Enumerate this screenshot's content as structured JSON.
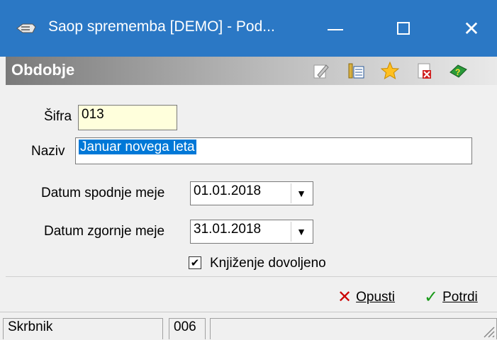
{
  "window": {
    "title": "Saop sprememba [DEMO] - Pod...",
    "minimize": "minimize",
    "maximize": "maximize",
    "close": "close"
  },
  "header": {
    "title": "Obdobje",
    "tools": [
      "edit-icon",
      "list-icon",
      "star-icon",
      "delete-icon",
      "help-book-icon"
    ]
  },
  "form": {
    "sifra_label": "Šifra",
    "sifra_value": "013",
    "naziv_label": "Naziv",
    "naziv_value": "Januar novega leta",
    "datum_spodnje_label": "Datum spodnje meje",
    "datum_spodnje_value": "01.01.2018",
    "datum_zgornje_label": "Datum zgornje meje",
    "datum_zgornje_value": "31.01.2018",
    "knjizenje_label": "Knjiženje dovoljeno",
    "knjizenje_checked": true
  },
  "buttons": {
    "opusti": "Opusti",
    "potrdi": "Potrdi"
  },
  "statusbar": {
    "left": "Skrbnik",
    "middle": "006",
    "right": ""
  },
  "colors": {
    "titlebar": "#2b78c5",
    "sifra_bg": "#ffffdc",
    "selection": "#0078d7",
    "cancel_icon": "#cc0000",
    "confirm_icon": "#1a9a1a"
  }
}
